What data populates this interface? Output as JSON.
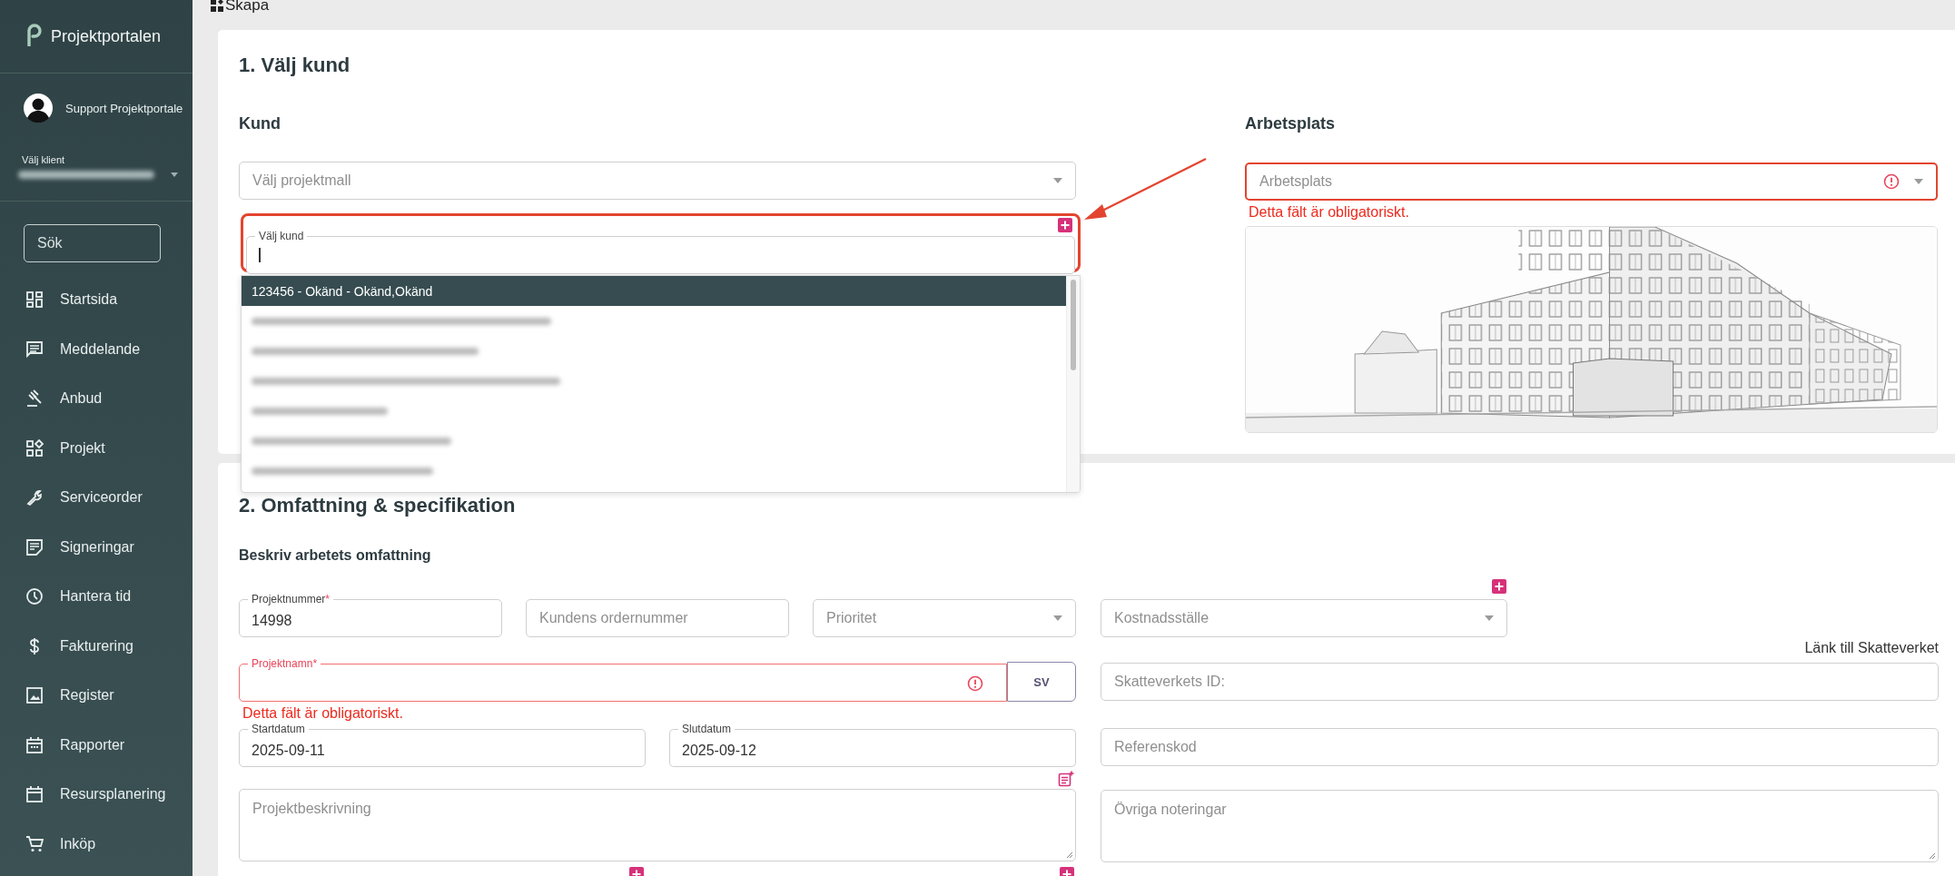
{
  "sidebar": {
    "brand": "Projektportalen",
    "user": "Support Projektportale",
    "client": {
      "label": "Välj klient",
      "redacted": true
    },
    "search": {
      "placeholder": "Sök"
    },
    "items": [
      {
        "label": "Startsida"
      },
      {
        "label": "Meddelande"
      },
      {
        "label": "Anbud"
      },
      {
        "label": "Projekt"
      },
      {
        "label": "Serviceorder"
      },
      {
        "label": "Signeringar"
      },
      {
        "label": "Hantera tid"
      },
      {
        "label": "Fakturering"
      },
      {
        "label": "Register"
      },
      {
        "label": "Rapporter"
      },
      {
        "label": "Resursplanering"
      },
      {
        "label": "Inköp"
      }
    ]
  },
  "header": {
    "title": "Skapa"
  },
  "section_1": {
    "title": "1. Välj kund",
    "kund": {
      "heading": "Kund",
      "template": {
        "placeholder": "Välj projektmall"
      },
      "customer": {
        "label": "Välj kund",
        "focused": true,
        "highlighted": true,
        "options": [
          {
            "label": "123456 - Okänd - Okänd,Okänd",
            "selected": true
          },
          {
            "redacted": true,
            "selected": false
          },
          {
            "redacted": true,
            "selected": false
          },
          {
            "redacted": true,
            "selected": false
          },
          {
            "redacted": true,
            "selected": false
          },
          {
            "redacted": true,
            "selected": false
          },
          {
            "redacted": true,
            "selected": false
          }
        ]
      }
    },
    "arbetsplats": {
      "heading": "Arbetsplats",
      "select": {
        "placeholder": "Arbetsplats",
        "error": "Detta fält är obligatoriskt."
      }
    }
  },
  "section_2": {
    "title": "2. Omfattning & specifikation",
    "subtitle": "Beskriv arbetets omfattning",
    "left_rows": [
      [
        {
          "kind": "text",
          "label": "Projektnummer",
          "required_mark": "*",
          "value": "14998"
        },
        {
          "kind": "text",
          "placeholder": "Kundens ordernummer"
        },
        {
          "kind": "select",
          "placeholder": "Prioritet"
        }
      ],
      [
        {
          "kind": "text",
          "label": "Projektnamn",
          "required_mark": "*",
          "error": "Detta fält är obligatoriskt.",
          "language": "SV"
        }
      ],
      [
        {
          "kind": "text",
          "label": "Startdatum",
          "value": "2025-09-11"
        },
        {
          "kind": "text",
          "label": "Slutdatum",
          "value": "2025-09-12"
        }
      ],
      [
        {
          "kind": "textarea",
          "placeholder": "Projektbeskrivning",
          "note_action": true
        }
      ],
      [
        {
          "kind": "add"
        },
        {
          "kind": "add"
        }
      ]
    ],
    "right_rows": [
      [
        {
          "kind": "select",
          "placeholder": "Kostnadsställe",
          "add_action": true
        }
      ],
      [
        {
          "kind": "text",
          "placeholder": "Skatteverkets ID:",
          "link": "Länk till Skatteverket"
        }
      ],
      [
        {
          "kind": "text",
          "placeholder": "Referenskod"
        }
      ],
      [
        {
          "kind": "textarea",
          "placeholder": "Övriga noteringar"
        }
      ]
    ]
  }
}
